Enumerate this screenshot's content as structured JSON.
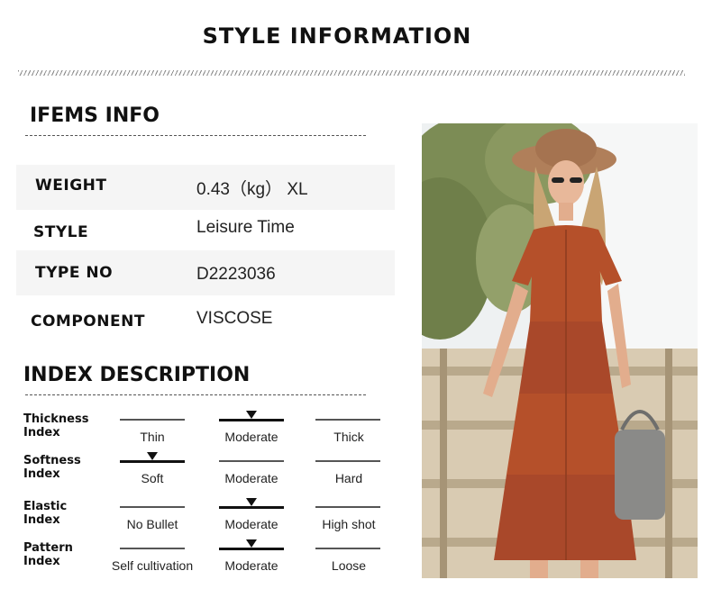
{
  "header": {
    "title": "STYLE INFORMATION"
  },
  "items_info": {
    "title": "IFEMS INFO",
    "rows": [
      {
        "label": "WEIGHT",
        "value": "0.43（kg） XL"
      },
      {
        "label": "STYLE",
        "value": "Leisure Time"
      },
      {
        "label": "TYPE NO",
        "value": "D2223036"
      },
      {
        "label": "COMPONENT",
        "value": "VISCOSE"
      }
    ]
  },
  "index_description": {
    "title": "INDEX DESCRIPTION",
    "rows": [
      {
        "label_line1": "Thickness",
        "label_line2": "Index",
        "options": [
          "Thin",
          "Moderate",
          "Thick"
        ],
        "selected": 1
      },
      {
        "label_line1": "Softness",
        "label_line2": "Index",
        "options": [
          "Soft",
          "Moderate",
          "Hard"
        ],
        "selected": 0
      },
      {
        "label_line1": "Elastic",
        "label_line2": "Index",
        "options": [
          "No Bullet",
          "Moderate",
          "High shot"
        ],
        "selected": 1
      },
      {
        "label_line1": "Pattern",
        "label_line2": "Index",
        "options": [
          "Self cultivation",
          "Moderate",
          "Loose"
        ],
        "selected": 1
      }
    ]
  },
  "colors": {
    "dress": "#b5502a",
    "hat": "#b07f5a",
    "sky": "#eef1f2",
    "foliage": "#7c8c55",
    "ground": "#d9cbb2"
  }
}
